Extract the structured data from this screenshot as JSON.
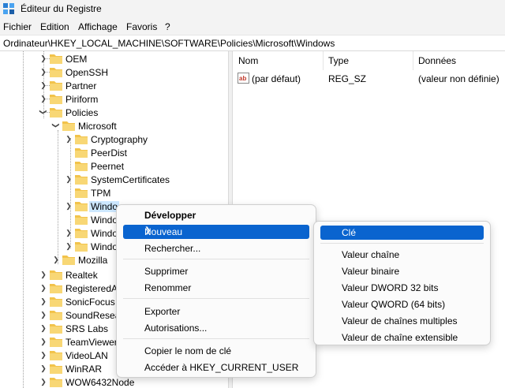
{
  "window": {
    "title": "Éditeur du Registre"
  },
  "menubar": [
    "Fichier",
    "Edition",
    "Affichage",
    "Favoris",
    "?"
  ],
  "address": "Ordinateur\\HKEY_LOCAL_MACHINE\\SOFTWARE\\Policies\\Microsoft\\Windows",
  "tree": {
    "items": [
      "OEM",
      "OpenSSH",
      "Partner",
      "Piriform",
      "Policies",
      "Microsoft",
      "Cryptography",
      "PeerDist",
      "Peernet",
      "SystemCertificates",
      "TPM",
      "Windo",
      "Windo",
      "Windo",
      "Windo",
      "Mozilla",
      "Realtek",
      "RegisteredAp",
      "SonicFocus",
      "SoundResear",
      "SRS Labs",
      "TeamViewer",
      "VideoLAN",
      "WinRAR",
      "WOW6432Node"
    ]
  },
  "list": {
    "columns": [
      "Nom",
      "Type",
      "Données"
    ],
    "rows": [
      {
        "name": "(par défaut)",
        "type": "REG_SZ",
        "data": "(valeur non définie)"
      }
    ]
  },
  "context_menu": {
    "items": [
      "Développer",
      "Nouveau",
      "Rechercher...",
      "Supprimer",
      "Renommer",
      "Exporter",
      "Autorisations...",
      "Copier le nom de clé",
      "Accéder à HKEY_CURRENT_USER"
    ]
  },
  "submenu": {
    "items": [
      "Clé",
      "Valeur chaîne",
      "Valeur binaire",
      "Valeur DWORD 32 bits",
      "Valeur QWORD (64 bits)",
      "Valeur de chaînes multiples",
      "Valeur de chaîne extensible"
    ]
  },
  "colors": {
    "highlight": "#0a64cf",
    "folder": "#f2c34b",
    "selection": "#cde8ff"
  }
}
